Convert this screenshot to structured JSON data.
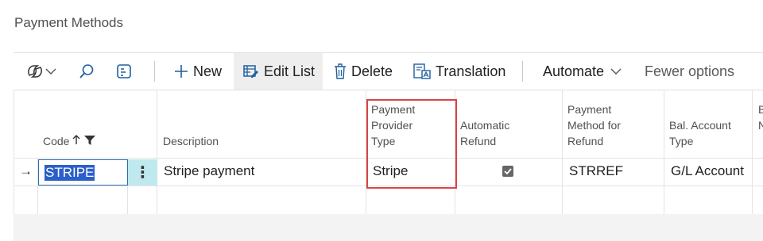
{
  "page": {
    "title": "Payment Methods"
  },
  "toolbar": {
    "new_label": "New",
    "edit_list_label": "Edit List",
    "delete_label": "Delete",
    "translation_label": "Translation",
    "automate_label": "Automate",
    "fewer_options_label": "Fewer options"
  },
  "columns": {
    "code": "Code",
    "description": "Description",
    "payment_provider_type": [
      "Payment",
      "Provider",
      "Type"
    ],
    "automatic_refund": [
      "Automatic",
      "Refund"
    ],
    "payment_method_for_refund": [
      "Payment",
      "Method for",
      "Refund"
    ],
    "bal_account_type": [
      "Bal. Account",
      "Type"
    ],
    "next_col_fragment": [
      "B",
      "N"
    ]
  },
  "rows": [
    {
      "code": "STRIPE",
      "description": "Stripe payment",
      "payment_provider_type": "Stripe",
      "automatic_refund": true,
      "payment_method_for_refund": "STRREF",
      "bal_account_type": "G/L Account"
    }
  ],
  "colors": {
    "highlight": "#d64545",
    "selection": "#2b5fc9",
    "active_cell": "#bfe9ef"
  }
}
